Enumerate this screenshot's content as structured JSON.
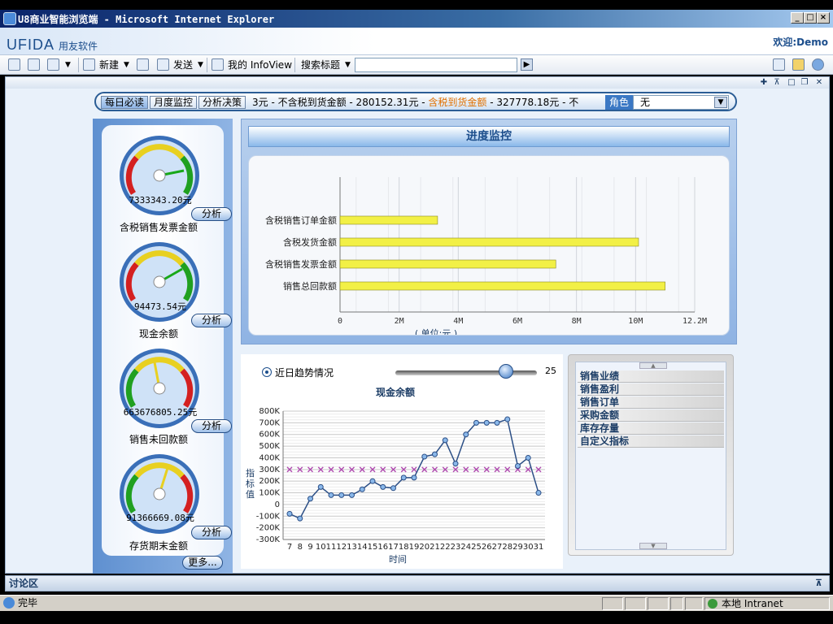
{
  "window": {
    "title": "U8商业智能浏览端 - Microsoft Internet Explorer",
    "min": "_",
    "max": "□",
    "close": "×"
  },
  "brand": {
    "logo": "UFIDA",
    "logo_sub": "用友软件",
    "welcome": "欢迎:Demo"
  },
  "toolbar": {
    "new_label": "新建",
    "send_label": "发送",
    "infoview_label": "我的 InfoView",
    "search_label": "搜索标题",
    "search_value": "",
    "go_label": "▶"
  },
  "tabs": {
    "t1": "每日必读",
    "t2": "月度监控",
    "t3": "分析决策"
  },
  "ticker": {
    "seg1": "3元 - 不含税到货金额 - 280152.31元 - ",
    "seg2": "含税到货金额",
    "seg3": " - 327778.18元 - 不"
  },
  "role": {
    "label": "角色",
    "value": "无"
  },
  "gauges": [
    {
      "value": "7333343.20元",
      "label": "含税销售发票金额",
      "button": "分析"
    },
    {
      "value": "94473.54元",
      "label": "现金余额",
      "button": "分析"
    },
    {
      "value": "663676805.25元",
      "label": "销售未回款额",
      "button": "分析"
    },
    {
      "value": "91366669.08元",
      "label": "存货期末金额",
      "button": "分析"
    }
  ],
  "more_button": "更多...",
  "progress": {
    "title": "进度监控",
    "chart_data": {
      "type": "bar",
      "orientation": "horizontal",
      "categories": [
        "含税销售订单金额",
        "含税发货金额",
        "含税销售发票金额",
        "销售总回款额"
      ],
      "values": [
        3300000,
        10100000,
        7300000,
        11000000
      ],
      "xlim": [
        0,
        12000000
      ],
      "ticks": [
        "0",
        "2M",
        "4M",
        "6M",
        "8M",
        "10M",
        "12.2M"
      ],
      "xlabel": "( 单位:元 )",
      "bar_color": "#f2f046",
      "grid": true
    }
  },
  "trend": {
    "radio_label": "近日趋势情况",
    "slider_value": "25",
    "slider_fraction": 0.78,
    "chart_data": {
      "type": "line",
      "title": "现金余额",
      "ylabel": "指标值",
      "xlabel": "时间",
      "x": [
        "7",
        "8",
        "9",
        "10",
        "11",
        "12",
        "13",
        "14",
        "15",
        "16",
        "17",
        "18",
        "19",
        "20",
        "21",
        "22",
        "23",
        "24",
        "25",
        "26",
        "27",
        "28",
        "29",
        "30",
        "31"
      ],
      "values": [
        -80,
        -120,
        50,
        150,
        80,
        80,
        80,
        130,
        200,
        150,
        140,
        230,
        230,
        410,
        430,
        550,
        350,
        600,
        700,
        700,
        700,
        730,
        330,
        400,
        100
      ],
      "reference": 300,
      "ylim": [
        -300,
        800
      ],
      "yticks": [
        "800K",
        "700K",
        "600K",
        "500K",
        "400K",
        "300K",
        "200K",
        "100K",
        "0",
        "-100K",
        "-200K",
        "-300K"
      ],
      "grid": true
    }
  },
  "indicators": {
    "up": "▲",
    "down": "▼",
    "items": [
      "销售业绩",
      "销售盈利",
      "销售订单",
      "采购金额",
      "库存存量",
      "自定义指标"
    ]
  },
  "discuss": {
    "label": "讨论区",
    "up": "⊼"
  },
  "status": {
    "text": "完毕",
    "zone": "本地 Intranet"
  }
}
